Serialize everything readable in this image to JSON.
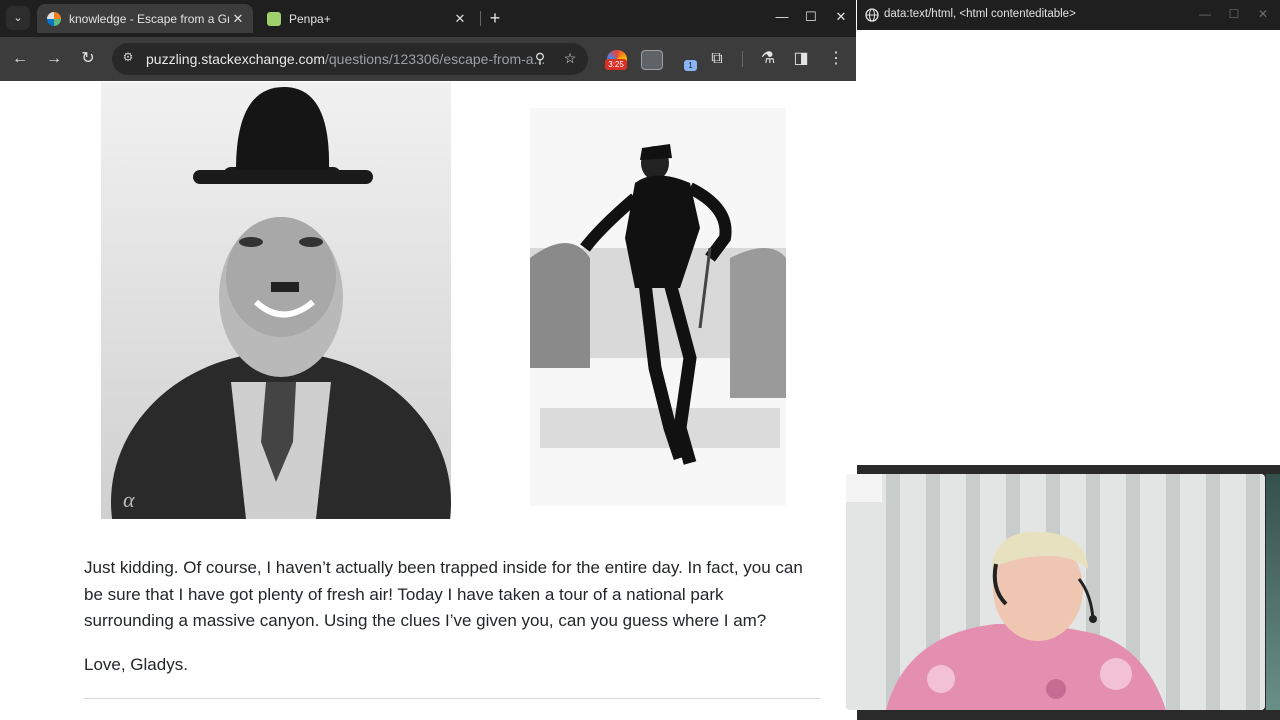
{
  "browser": {
    "tabs": [
      {
        "title": "knowledge - Escape from a Gre",
        "active": true
      },
      {
        "title": "Penpa+",
        "active": false
      }
    ],
    "url_host": "puzzling.stackexchange.com",
    "url_path": "/questions/123306/escape-from-a...",
    "extension_badge": "3:25",
    "extension_count": "1"
  },
  "page": {
    "watermark": "α",
    "paragraph1": "Just kidding. Of course, I haven’t actually been trapped inside for the entire day. In fact, you can be sure that I have got plenty of fresh air! Today I have taken a tour of a national park surrounding a massive canyon. Using the clues I’ve given you, can you guess where I am?",
    "paragraph2": "Love, Gladys."
  },
  "second_window": {
    "title": "data:text/html, <html contenteditable>"
  },
  "icons": [
    "tab-search-icon",
    "close-icon",
    "new-tab-icon",
    "minimize-icon",
    "maximize-icon",
    "back-icon",
    "forward-icon",
    "reload-icon",
    "site-settings-icon",
    "zoom-icon",
    "star-icon",
    "extensions-icon",
    "labs-icon",
    "side-panel-icon",
    "menu-icon",
    "globe-icon"
  ]
}
